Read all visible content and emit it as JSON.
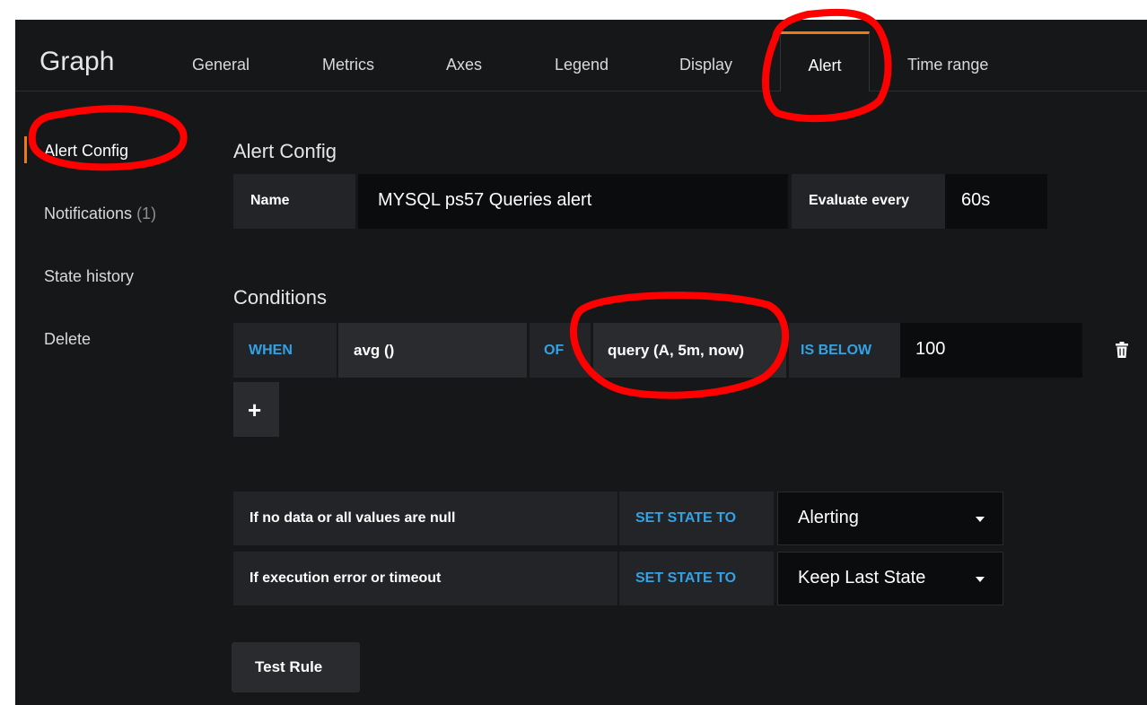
{
  "header": {
    "title": "Graph",
    "tabs": [
      "General",
      "Metrics",
      "Axes",
      "Legend",
      "Display",
      "Alert",
      "Time range"
    ],
    "active_tab": "Alert"
  },
  "sidebar": {
    "items": [
      {
        "label": "Alert Config",
        "count": ""
      },
      {
        "label": "Notifications",
        "count": "(1)"
      },
      {
        "label": "State history",
        "count": ""
      },
      {
        "label": "Delete",
        "count": ""
      }
    ]
  },
  "alert_config": {
    "heading": "Alert Config",
    "name_label": "Name",
    "name_value": "MYSQL ps57 Queries alert",
    "evaluate_label": "Evaluate every",
    "evaluate_value": "60s"
  },
  "conditions": {
    "heading": "Conditions",
    "when_label": "WHEN",
    "reducer": "avg ()",
    "of_label": "OF",
    "query": "query (A, 5m, now)",
    "evaluator": "IS BELOW",
    "threshold": "100",
    "add_label": "+",
    "delete_icon": "trash-icon"
  },
  "no_data": {
    "label": "If no data or all values are null",
    "set_state_label": "SET STATE TO",
    "value": "Alerting"
  },
  "exec_error": {
    "label": "If execution error or timeout",
    "set_state_label": "SET STATE TO",
    "value": "Keep Last State"
  },
  "test_rule": {
    "label": "Test Rule"
  },
  "colors": {
    "background": "#161719",
    "accent": "#eb7b18",
    "keyword": "#33a2e5",
    "annotation": "#ff0000"
  }
}
